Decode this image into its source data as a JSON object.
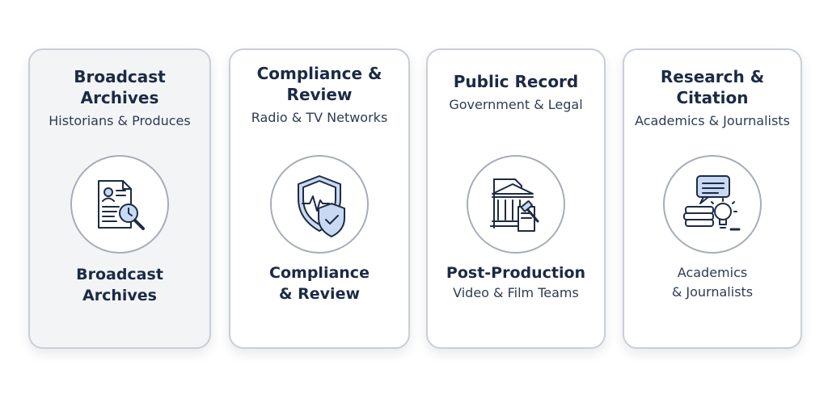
{
  "cards": [
    {
      "title": "Broadcast\nArchives",
      "subtitle": "Historians & Produces",
      "icon": "document-search-icon",
      "bottom_title": "Broadcast\nArchives"
    },
    {
      "title": "Compliance &\nReview",
      "subtitle": "Radio & TV Networks",
      "icon": "shield-check-icon",
      "bottom_title": "Compliance\n& Review"
    },
    {
      "title": "Public Record",
      "subtitle": "Government & Legal",
      "icon": "courthouse-gavel-icon",
      "bottom_title": "Post-Production",
      "bottom_subtitle": "Video & Film Teams"
    },
    {
      "title": "Research &\nCitation",
      "subtitle": "Academics & Journalists",
      "icon": "books-lightbulb-icon",
      "bottom_subtitle": "Academics\n& Journalists"
    }
  ],
  "colors": {
    "card_border": "#c9ced6",
    "card_highlight_bg": "#f3f4f6",
    "icon_stroke": "#1d2b44",
    "icon_accent": "#c9d9f4"
  }
}
